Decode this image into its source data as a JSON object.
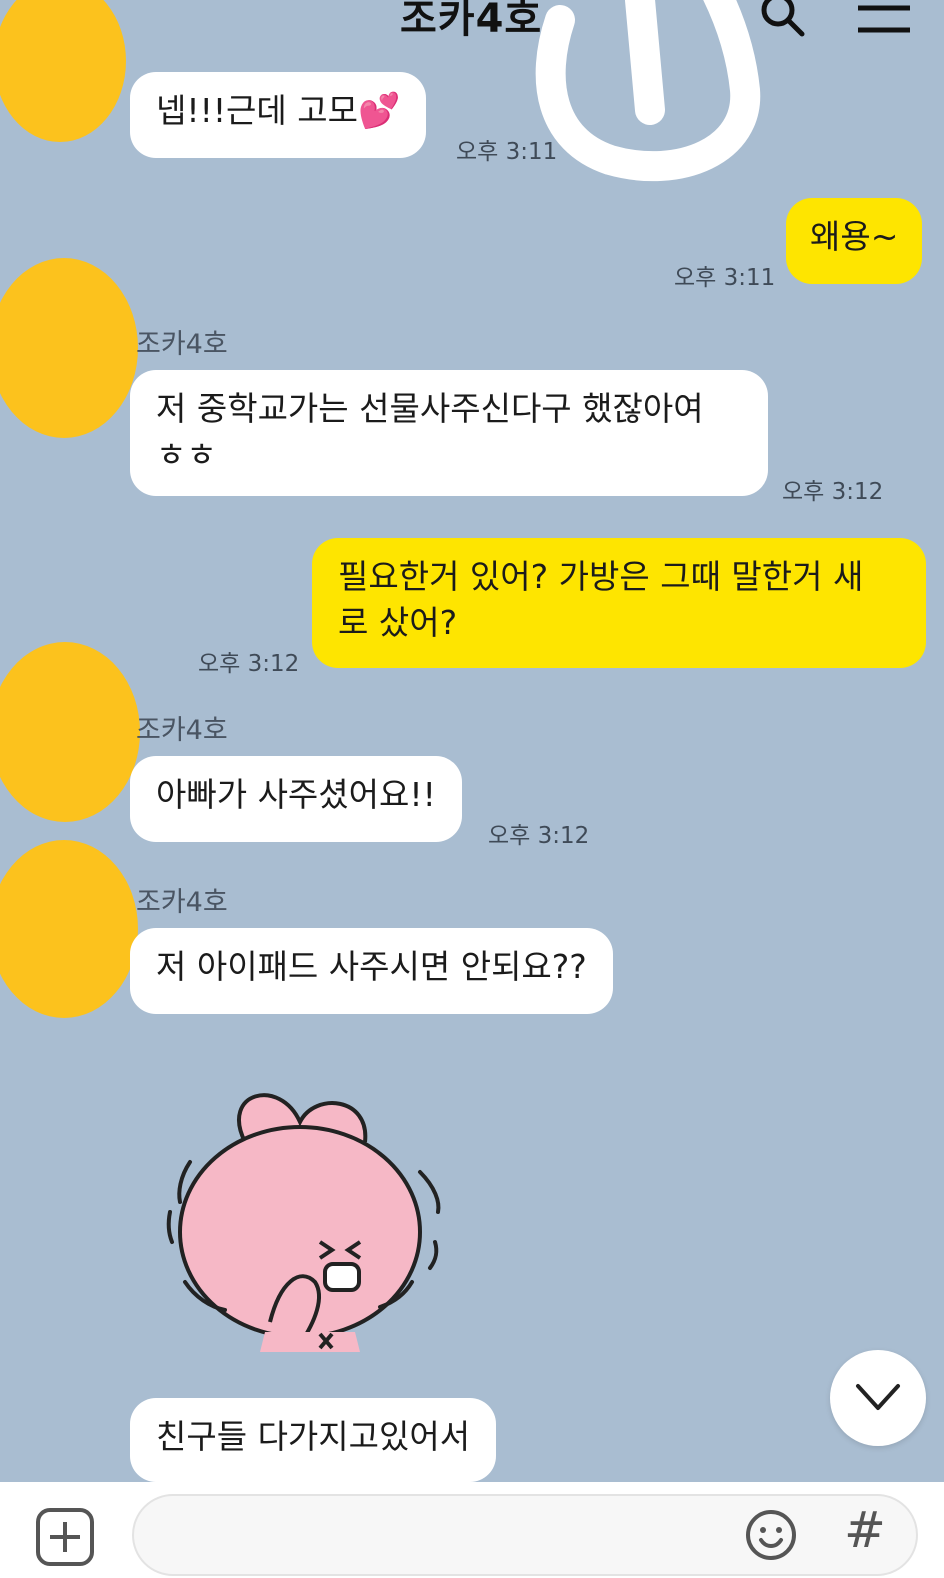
{
  "header": {
    "title": "조카4호",
    "search_icon": "search-icon",
    "menu_icon": "menu-icon"
  },
  "messages": [
    {
      "sender": "조카4호",
      "text": "넵!!!근데 고모",
      "emoji": "💕",
      "time": "오후 3:11"
    },
    {
      "text": "왜용~",
      "time": "오후 3:11"
    },
    {
      "sender": "조카4호",
      "text": "저 중학교가는 선물사주신다구 했잖아여\nㅎㅎ",
      "time": "오후 3:12"
    },
    {
      "text": "필요한거 있어? 가방은 그때 말한거 새\n로 샀어?",
      "time": "오후 3:12"
    },
    {
      "sender": "조카4호",
      "text": "아빠가 사주셨어요!!",
      "time": "오후 3:12"
    },
    {
      "sender": "조카4호",
      "text": "저 아이패드 사주시면 안되요??"
    },
    {
      "text": "친구들 다가지고있어서"
    }
  ],
  "sticker": {
    "description_icon": "pink-bunny-sticker-icon"
  },
  "input": {
    "placeholder": "",
    "attach_icon": "plus-square-icon",
    "emoji_icon": "smiley-icon",
    "hash_label": "#"
  },
  "colors": {
    "background": "#a9bdd1",
    "mine_bubble": "#fee500",
    "other_bubble": "#ffffff",
    "avatar_redaction": "#fcc21d"
  }
}
